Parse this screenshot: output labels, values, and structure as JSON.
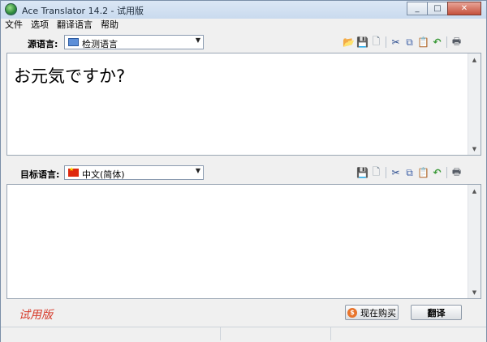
{
  "window": {
    "title": "Ace Translator 14.2 - 试用版"
  },
  "caption": {
    "minimize": "_",
    "maximize": "□",
    "close": "✕"
  },
  "menu": [
    "文件",
    "选项",
    "翻译语言",
    "帮助"
  ],
  "source": {
    "label": "源语言:",
    "language": "检测语言",
    "text": "お元気ですか?"
  },
  "target": {
    "label": "目标语言:",
    "language": "中文(简体)",
    "text": ""
  },
  "toolbar_icons": [
    "open-icon",
    "save-icon",
    "new-document-icon",
    "cut-icon",
    "copy-icon",
    "paste-icon",
    "undo-icon",
    "print-icon"
  ],
  "footer": {
    "trial_label": "试用版",
    "buy_label": "现在购买",
    "buy_icon_glyph": "$",
    "translate_label": "翻译"
  },
  "colors": {
    "trial_text": "#d63a2a",
    "title_bar": "#c9daee"
  }
}
